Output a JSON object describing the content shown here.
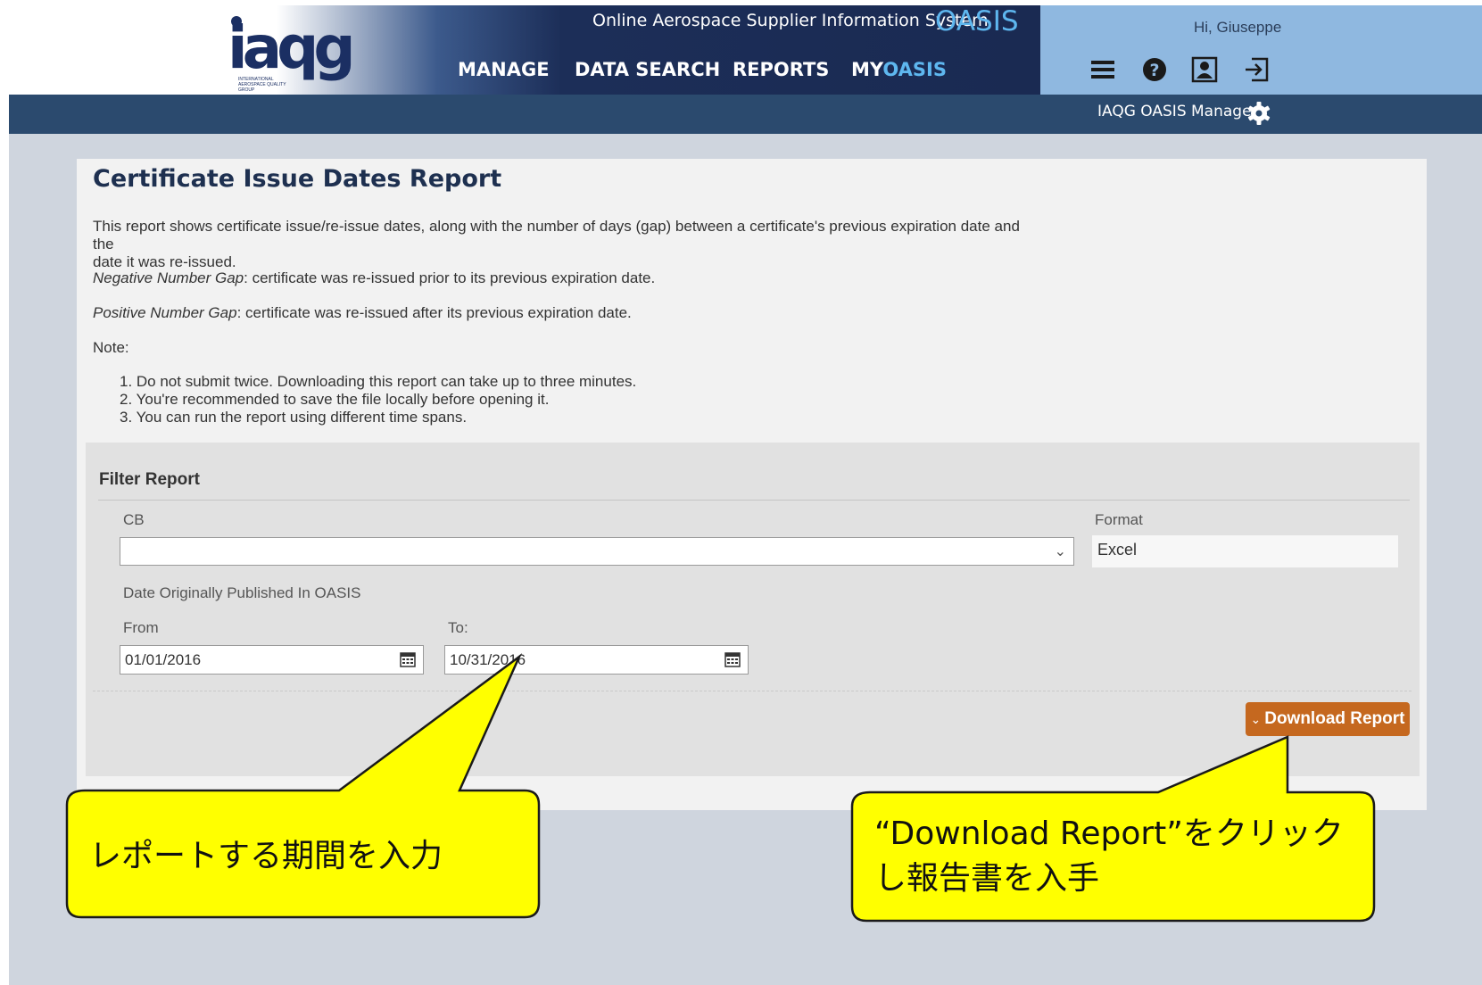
{
  "header": {
    "logo_text": "iaqg",
    "logo_subtext": "INTERNATIONAL AEROSPACE QUALITY GROUP",
    "system_title": "Online Aerospace Supplier Information System",
    "system_brand": "OASIS",
    "nav": [
      {
        "label": "MANAGE"
      },
      {
        "label": "DATA SEARCH"
      },
      {
        "label": "REPORTS"
      },
      {
        "label_prefix": "MY",
        "label_accent": "OASIS"
      }
    ],
    "greeting": "Hi, Giuseppe",
    "icons": [
      "menu-icon",
      "help-icon",
      "profile-icon",
      "logout-icon"
    ],
    "manager_label": "IAQG OASIS Manager",
    "colors": {
      "brand_accent": "#5eb7ef",
      "nav_bg": "#1a2a52",
      "subbar_bg": "#2b4a6e",
      "user_panel": "#8fb8e0"
    }
  },
  "report": {
    "title": "Certificate Issue Dates Report",
    "description_line1": "This report shows certificate issue/re-issue dates, along with the number of days (gap) between a certificate's previous expiration date and the",
    "description_line2": "date it was re-issued.",
    "negative_term": "Negative Number Gap",
    "negative_text": ": certificate was re-issued prior to its previous expiration date.",
    "positive_term": "Positive Number Gap",
    "positive_text": ": certificate was re-issued after its previous expiration date.",
    "note_label": "Note:",
    "notes": [
      "1. Do not submit twice. Downloading this report can take up to three minutes.",
      "2. You're recommended to save the file locally before opening it.",
      "3. You can run the report using different time spans."
    ]
  },
  "filter": {
    "title": "Filter Report",
    "cb_label": "CB",
    "cb_value": "",
    "format_label": "Format",
    "format_value": "Excel",
    "date_section_label": "Date Originally Published In OASIS",
    "from_label": "From",
    "from_value": "01/01/2016",
    "to_label": "To:",
    "to_value": "10/31/2016",
    "download_label": "Download Report",
    "download_color": "#c5681f"
  },
  "callouts": {
    "left_text": "レポートする期間を入力",
    "right_line1": "“Download Report”をクリック",
    "right_line2": "し報告書を入手",
    "fill_color": "#ffff00"
  }
}
